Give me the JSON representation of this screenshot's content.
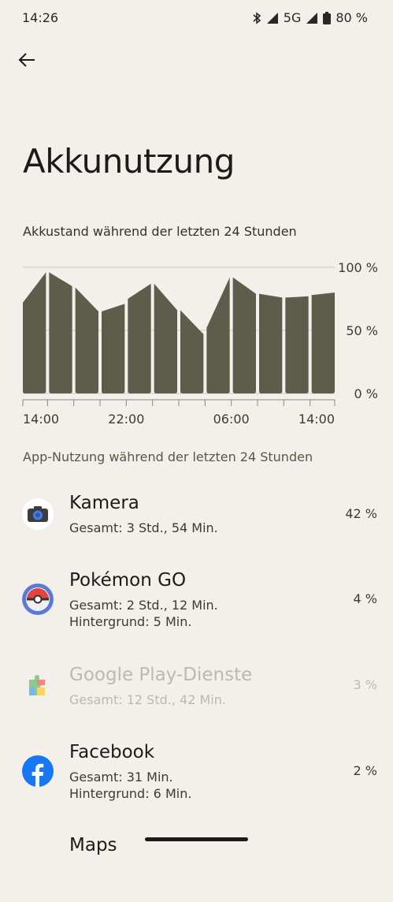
{
  "status": {
    "time": "14:26",
    "network": "5G",
    "battery": "80 %"
  },
  "page": {
    "title": "Akkunutzung"
  },
  "chart_title": "Akkustand während der letzten 24 Stunden",
  "section_title": "App-Nutzung während der letzten 24 Stunden",
  "chart_data": {
    "type": "bar",
    "title": "Akkustand während der letzten 24 Stunden",
    "y_tick_labels": [
      "100 %",
      "50 %",
      "0 %"
    ],
    "ylim": [
      0,
      100
    ],
    "x_tick_labels": [
      "14:00",
      "22:00",
      "06:00",
      "14:00"
    ],
    "grid": true,
    "bars": [
      {
        "start": 72,
        "end": 96
      },
      {
        "start": 96,
        "end": 85
      },
      {
        "start": 84,
        "end": 65
      },
      {
        "start": 65,
        "end": 71
      },
      {
        "start": 75,
        "end": 87
      },
      {
        "start": 87,
        "end": 66
      },
      {
        "start": 66,
        "end": 47
      },
      {
        "start": 52,
        "end": 92
      },
      {
        "start": 92,
        "end": 79
      },
      {
        "start": 79,
        "end": 76
      },
      {
        "start": 76,
        "end": 77
      },
      {
        "start": 78,
        "end": 80
      }
    ]
  },
  "apps": [
    {
      "name": "Kamera",
      "detail1": "Gesamt: 3 Std., 54 Min.",
      "detail2": "",
      "pct": "42 %"
    },
    {
      "name": "Pokémon GO",
      "detail1": "Gesamt: 2 Std., 12 Min.",
      "detail2": "Hintergrund: 5 Min.",
      "pct": "4 %"
    },
    {
      "name": "Google Play-Dienste",
      "detail1": "Gesamt: 12 Std., 42 Min.",
      "detail2": "",
      "pct": "3 %"
    },
    {
      "name": "Facebook",
      "detail1": "Gesamt: 31 Min.",
      "detail2": "Hintergrund: 6 Min.",
      "pct": "2 %"
    },
    {
      "name": "Maps"
    }
  ],
  "colors": {
    "background": "#f3efea",
    "bar": "#5e5d4b",
    "grid": "#cfcac2"
  }
}
